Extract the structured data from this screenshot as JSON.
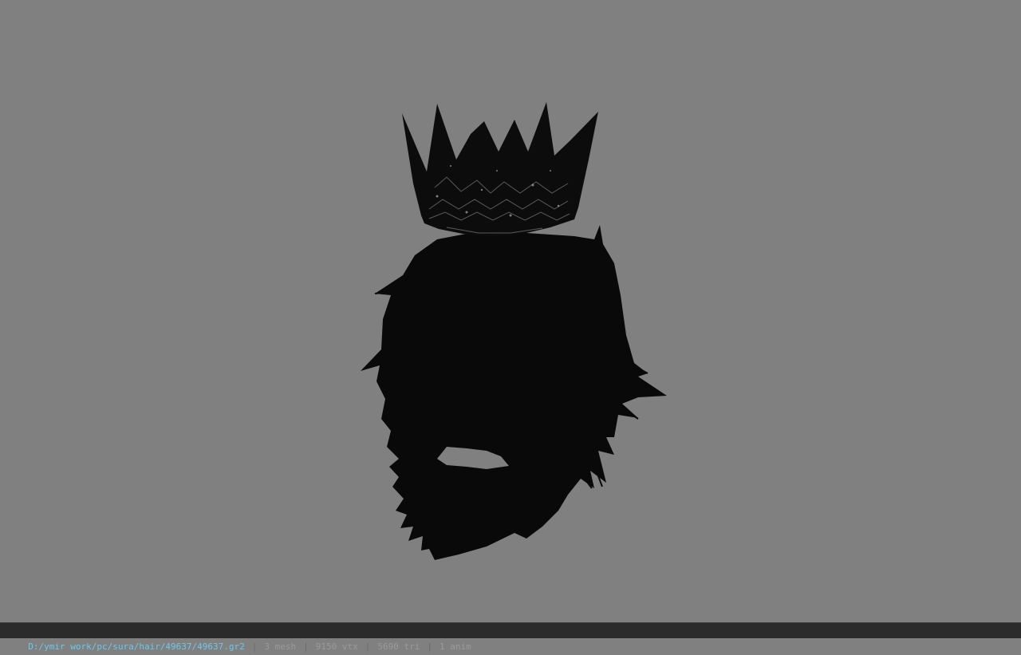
{
  "viewport": {
    "background": "#808080",
    "model_color": "#0b0b0b",
    "subject": "crown-and-hair-model"
  },
  "status": {
    "path": "D:/ymir work/pc/sura/hair/49637/49637.gr2",
    "sep": "|",
    "mesh": "3 mesh",
    "vtx": "9150 vtx",
    "tri": "5690 tri",
    "anim": "1 anim",
    "path_color": "#6ec6e6"
  }
}
